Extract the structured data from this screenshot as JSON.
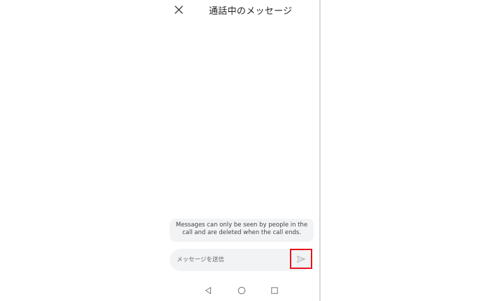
{
  "header": {
    "title": "通話中のメッセージ",
    "close_icon": "close-icon"
  },
  "notice": {
    "text": "Messages can only be seen by people in the call and are deleted when the call ends."
  },
  "composer": {
    "placeholder": "メッセージを送信",
    "value": "",
    "send_icon": "send-icon",
    "highlight_color": "#e8141b"
  },
  "nav_bar": {
    "items": [
      "back-icon",
      "home-icon",
      "recents-icon"
    ]
  },
  "colors": {
    "background": "#ffffff",
    "surface": "#f1f3f4",
    "text": "#222222",
    "divider": "#d9d9d9"
  }
}
